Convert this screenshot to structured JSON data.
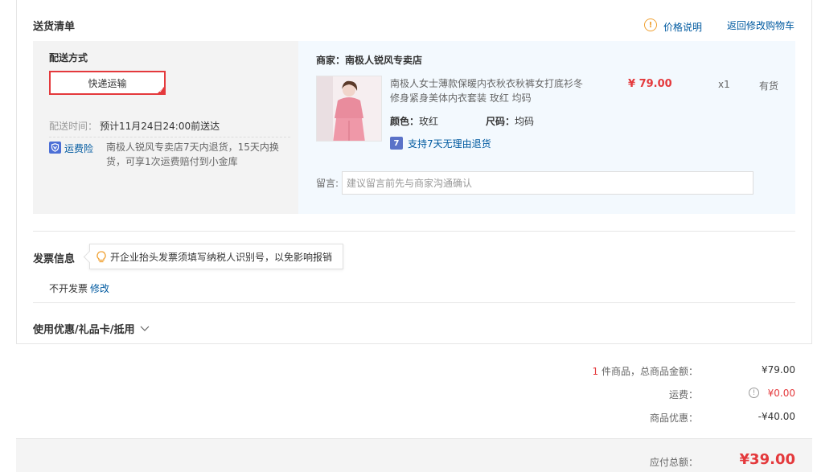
{
  "delivery": {
    "title": "送货清单",
    "price_note": "价格说明",
    "back_to_cart": "返回修改购物车",
    "method_label": "配送方式",
    "method_selected": "快递运输",
    "time_label": "配送时间：",
    "time_value": "预计11月24日24:00前送达",
    "insurance_label": "运费险",
    "insurance_icon": "shield-icon",
    "insurance_text_line1": "南极人锐风专卖店7天内退货，15天内换",
    "insurance_text_line2": "货，可享1次运费赔付到小金库"
  },
  "order": {
    "shop": "商家：南极人锐风专卖店",
    "product_name_line1": "南极人女士薄款保暖内衣秋衣秋裤女打底衫冬",
    "product_name_line2": "修身紧身美体内衣套装 玫红 均码",
    "price": "¥ 79.00",
    "quantity": "x1",
    "stock": "有货",
    "color_label": "颜色：",
    "color_value": "玫红",
    "size_label": "尺码：",
    "size_value": "均码",
    "return_policy": "支持7天无理由退货",
    "remark_label": "留言:",
    "remark_placeholder": "建议留言前先与商家沟通确认",
    "remark_value": ""
  },
  "invoice": {
    "title": "发票信息",
    "tip": "开企业抬头发票须填写纳税人识别号，以免影响报销",
    "status": "不开发票",
    "edit": "修改"
  },
  "coupons": {
    "title": "使用优惠/礼品卡/抵用"
  },
  "summary": {
    "count": "1",
    "count_suffix": "件商品，总商品金额：",
    "goods_total": "¥79.00",
    "shipping_label": "运费：",
    "shipping_value": "¥0.00",
    "discount_label": "商品优惠：",
    "discount_value": "-¥40.00",
    "payable_label": "应付总额：",
    "payable_value": "¥39.00"
  },
  "colors": {
    "accent_red": "#e4393c",
    "link_blue": "#005aa0",
    "panel_gray": "#f3f3f3",
    "panel_blue": "#f3f9fe"
  }
}
